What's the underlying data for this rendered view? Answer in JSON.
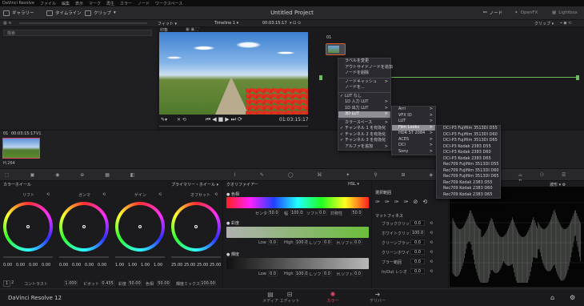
{
  "menubar": {
    "items": [
      "DaVinci Resolve",
      "ファイル",
      "編集",
      "表示",
      "マーク",
      "再生",
      "カラー",
      "ノード",
      "ワークスペース"
    ]
  },
  "toolbar": {
    "gallery": "ギャラリー",
    "timelines": "タイムライン",
    "clips": "クリップ",
    "project_title": "Untitled Project",
    "nodes": "ノード",
    "openfx": "OpenFX",
    "lightbox": "Lightbox"
  },
  "subbar": {
    "fit": "フィット",
    "timeline": "Timeline 1",
    "timecode": "00:03:15:17",
    "clip_label": "クリップ"
  },
  "gallery": {
    "search_placeholder": "検索",
    "album_label": "印象"
  },
  "viewer": {
    "timecode": "01:03:15:17"
  },
  "clip_strip": {
    "clip_num": "01",
    "clip_tc": "00:03:15:17",
    "clip_track": "V1",
    "codec": "H.264"
  },
  "node": {
    "label": "01"
  },
  "context_menu": {
    "items": [
      {
        "label": "ラベルを変更",
        "check": ""
      },
      {
        "label": "アウトサイドノードを追加",
        "check": ""
      },
      {
        "label": "ノードを削除",
        "check": ""
      },
      {
        "label": "ノードキャッシュ",
        "check": "",
        "arrow": ">"
      },
      {
        "label": "ノードを...",
        "check": ""
      },
      {
        "label": "LUT なし",
        "check": "✓"
      },
      {
        "label": "1D 入力 LUT",
        "check": "",
        "arrow": ">"
      },
      {
        "label": "1D 出力 LUT",
        "check": "",
        "arrow": ">"
      },
      {
        "label": "3D LUT",
        "check": "",
        "arrow": ">"
      },
      {
        "label": "カラースペース",
        "check": "",
        "arrow": ">"
      },
      {
        "label": "チャンネル 1 を有効化",
        "check": "✓"
      },
      {
        "label": "チャンネル 2 を有効化",
        "check": "✓"
      },
      {
        "label": "チャンネル 3 を有効化",
        "check": "✓"
      },
      {
        "label": "アルファを追加",
        "check": "",
        "arrow": ">"
      }
    ]
  },
  "submenu_lut": {
    "items": [
      "Arri",
      "VFX IO",
      "LUT",
      "Film Looks",
      "HDR ST 2084",
      "ACES",
      "DCI",
      "Sony"
    ]
  },
  "submenu_film": {
    "items": [
      "DCI-P3 Fujifilm 3513DI D55",
      "DCI-P3 Fujifilm 3513DI D60",
      "DCI-P3 Fujifilm 3513DI D65",
      "DCI-P3 Kodak 2383 D55",
      "DCI-P3 Kodak 2383 D60",
      "DCI-P3 Kodak 2383 D65",
      "Rec709 Fujifilm 3513DI D55",
      "Rec709 Fujifilm 3513DI D60",
      "Rec709 Fujifilm 3513DI D65",
      "Rec709 Kodak 2383 D55",
      "Rec709 Kodak 2383 D60",
      "Rec709 Kodak 2383 D65"
    ]
  },
  "panel_labels": {
    "color_wheels": "カラーホイール",
    "primaries": "プライマリー・ホイール",
    "qualifier": "クオリファイアー",
    "hsl": "HSL",
    "selection": "選択範囲",
    "matte_finesse": "マットフィネス",
    "scope_mode": "波形"
  },
  "wheels": [
    {
      "name": "リフト",
      "vals": [
        "0.00",
        "0.00",
        "0.00",
        "0.00"
      ]
    },
    {
      "name": "ガンマ",
      "vals": [
        "0.00",
        "0.00",
        "0.00",
        "0.00"
      ]
    },
    {
      "name": "ゲイン",
      "vals": [
        "1.00",
        "1.00",
        "1.00",
        "1.00"
      ]
    },
    {
      "name": "オフセット",
      "vals": [
        "25.00",
        "25.00",
        "25.00",
        "25.00"
      ]
    }
  ],
  "wheel_footer": {
    "page1": "1",
    "page2": "2",
    "contrast_label": "コントラスト",
    "contrast": "1.000",
    "pivot_label": "ピボット",
    "pivot": "0.435",
    "sat_label": "彩度",
    "sat": "50.00",
    "hue_label": "色相",
    "hue": "50.00",
    "lum_label": "輝度ミックス",
    "lum": "100.00"
  },
  "qualifier": {
    "hue": {
      "title": "色相",
      "center_label": "センター",
      "center": "50.0",
      "width_label": "幅",
      "width": "100.0",
      "soft_label": "ソフト",
      "soft": "0.0",
      "sym_label": "対称性",
      "sym": "50.0"
    },
    "sat": {
      "title": "彩度",
      "low_label": "Low",
      "low": "0.0",
      "high_label": "High",
      "high": "100.0",
      "lsoft_label": "L.ソフト",
      "lsoft": "0.0",
      "hsoft_label": "H.ソフト",
      "hsoft": "0.0"
    },
    "lum": {
      "title": "輝度",
      "low_label": "Low",
      "low": "0.0",
      "high_label": "High",
      "high": "100.0",
      "lsoft_label": "L.ソフト",
      "lsoft": "0.0",
      "hsoft_label": "H.ソフト",
      "hsoft": "0.0"
    }
  },
  "matte": {
    "rows": [
      {
        "label": "ブラッククリップ",
        "value": "0.0"
      },
      {
        "label": "ホワイトクリップ",
        "value": "100.0"
      },
      {
        "label": "クリーンブラック",
        "value": "0.0"
      },
      {
        "label": "クリーンホワイト",
        "value": "0.0"
      },
      {
        "label": "ブラー範囲",
        "value": "0.0"
      },
      {
        "label": "In/Out レシオ",
        "value": "0.0"
      }
    ]
  },
  "bottombar": {
    "app": "DaVinci Resolve 12",
    "tabs": [
      "メディア",
      "エディット",
      "カラー",
      "デリバー"
    ]
  },
  "colors": {
    "accent": "#d85a20",
    "active_tab": "#e04868"
  }
}
